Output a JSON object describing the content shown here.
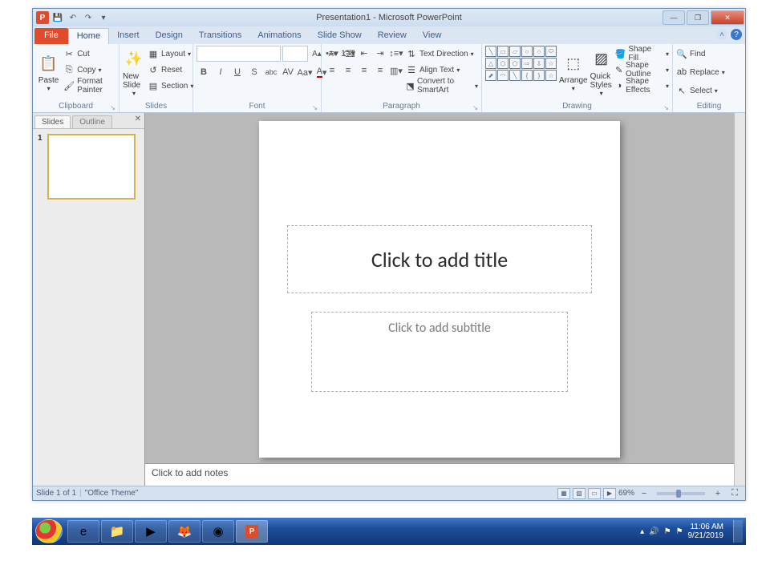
{
  "titlebar": {
    "title": "Presentation1 - Microsoft PowerPoint"
  },
  "tabs": {
    "file": "File",
    "items": [
      "Home",
      "Insert",
      "Design",
      "Transitions",
      "Animations",
      "Slide Show",
      "Review",
      "View"
    ],
    "active": "Home"
  },
  "ribbon": {
    "clipboard": {
      "label": "Clipboard",
      "paste": "Paste",
      "cut": "Cut",
      "copy": "Copy",
      "format_painter": "Format Painter"
    },
    "slides": {
      "label": "Slides",
      "new_slide": "New Slide",
      "layout": "Layout",
      "reset": "Reset",
      "section": "Section"
    },
    "font": {
      "label": "Font"
    },
    "paragraph": {
      "label": "Paragraph",
      "text_direction": "Text Direction",
      "align_text": "Align Text",
      "convert_smartart": "Convert to SmartArt"
    },
    "drawing": {
      "label": "Drawing",
      "arrange": "Arrange",
      "quick_styles": "Quick Styles",
      "shape_fill": "Shape Fill",
      "shape_outline": "Shape Outline",
      "shape_effects": "Shape Effects"
    },
    "editing": {
      "label": "Editing",
      "find": "Find",
      "replace": "Replace",
      "select": "Select"
    }
  },
  "leftpanel": {
    "tab_slides": "Slides",
    "tab_outline": "Outline",
    "thumb_num": "1"
  },
  "slide": {
    "title_placeholder": "Click to add title",
    "subtitle_placeholder": "Click to add subtitle"
  },
  "notes": {
    "placeholder": "Click to add notes"
  },
  "statusbar": {
    "slide_info": "Slide 1 of 1",
    "theme": "\"Office Theme\"",
    "zoom": "69%"
  },
  "taskbar": {
    "time": "11:06 AM",
    "date": "9/21/2019"
  }
}
